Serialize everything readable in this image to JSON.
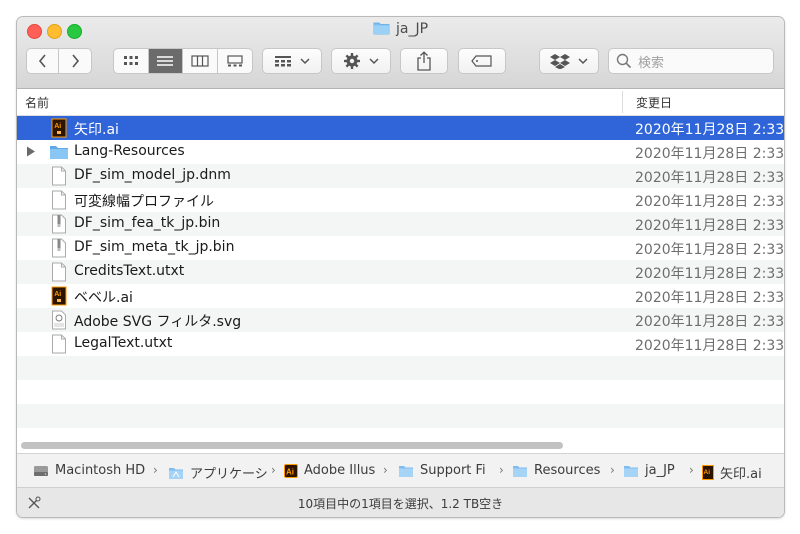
{
  "window": {
    "title": "ja_JP"
  },
  "toolbar": {
    "search_placeholder": "検索"
  },
  "columns": {
    "name": "名前",
    "date": "変更日"
  },
  "files": [
    {
      "name": "矢印.ai",
      "date": "2020年11月28日 2:33",
      "icon": "illustrator-file-icon",
      "selected": true
    },
    {
      "name": "Lang-Resources",
      "date": "2020年11月28日 2:33",
      "icon": "folder-icon",
      "expandable": true
    },
    {
      "name": "DF_sim_model_jp.dnm",
      "date": "2020年11月28日 2:33",
      "icon": "document-icon"
    },
    {
      "name": "可変線幅プロファイル",
      "date": "2020年11月28日 2:33",
      "icon": "document-icon"
    },
    {
      "name": "DF_sim_fea_tk_jp.bin",
      "date": "2020年11月28日 2:33",
      "icon": "binary-file-icon"
    },
    {
      "name": "DF_sim_meta_tk_jp.bin",
      "date": "2020年11月28日 2:33",
      "icon": "binary-file-icon"
    },
    {
      "name": "CreditsText.utxt",
      "date": "2020年11月28日 2:33",
      "icon": "document-icon"
    },
    {
      "name": "ベベル.ai",
      "date": "2020年11月28日 2:33",
      "icon": "illustrator-file-icon"
    },
    {
      "name": "Adobe SVG フィルタ.svg",
      "date": "2020年11月28日 2:33",
      "icon": "svg-file-icon"
    },
    {
      "name": "LegalText.utxt",
      "date": "2020年11月28日 2:33",
      "icon": "document-icon"
    }
  ],
  "path": [
    {
      "label": "Macintosh HD",
      "icon": "hard-drive-icon"
    },
    {
      "label": "アプリケーシ",
      "icon": "applications-folder-icon"
    },
    {
      "label": "Adobe Illus",
      "icon": "illustrator-app-icon"
    },
    {
      "label": "Support File",
      "icon": "folder-icon"
    },
    {
      "label": "Resources",
      "icon": "folder-icon"
    },
    {
      "label": "ja_JP",
      "icon": "folder-icon"
    },
    {
      "label": "矢印.ai",
      "icon": "illustrator-file-icon"
    }
  ],
  "status": {
    "text": "10項目中の1項目を選択、1.2 TB空き"
  },
  "colors": {
    "selection": "#2f65d9",
    "folder": "#6cb4ee",
    "illustrator": "#ff9a00"
  }
}
